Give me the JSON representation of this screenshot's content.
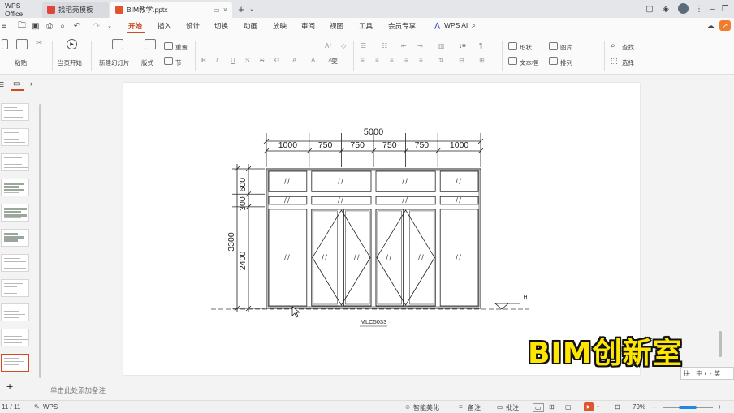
{
  "titlebar": {
    "tabs": [
      {
        "label": "WPS Office",
        "active": false
      },
      {
        "label": "找稻壳模板",
        "active": false
      },
      {
        "label": "BIM教学.pptx",
        "active": true
      }
    ],
    "new_tab": "+"
  },
  "menubar": {
    "items": [
      "开始",
      "插入",
      "设计",
      "切换",
      "动画",
      "放映",
      "审阅",
      "视图",
      "工具",
      "会员专享"
    ],
    "ai_label": "WPS AI",
    "active_index": 0
  },
  "ribbon": {
    "paste": "粘贴",
    "play": "当页开始",
    "new_slide": "新建幻灯片",
    "layout": "版式",
    "section": "节",
    "reset": "重置",
    "shape": "形状",
    "arrange": "排列",
    "textbox": "文本框",
    "picture": "图片",
    "find": "查找",
    "select": "选择"
  },
  "drawing": {
    "total_width": "5000",
    "widths": [
      "1000",
      "750",
      "750",
      "750",
      "750",
      "1000"
    ],
    "total_height": "3300",
    "heights": [
      "600",
      "300",
      "2400"
    ],
    "label": "MLC5033",
    "elev_mark": "H"
  },
  "notes_placeholder": "单击此处添加备注",
  "statusbar": {
    "page": "11 / 11",
    "app": "WPS",
    "beautify": "智能美化",
    "notes": "备注",
    "comment": "批注",
    "zoom": "79%"
  },
  "watermark": "BIM创新室",
  "ime": "拼 · 中 ◐ · 英"
}
